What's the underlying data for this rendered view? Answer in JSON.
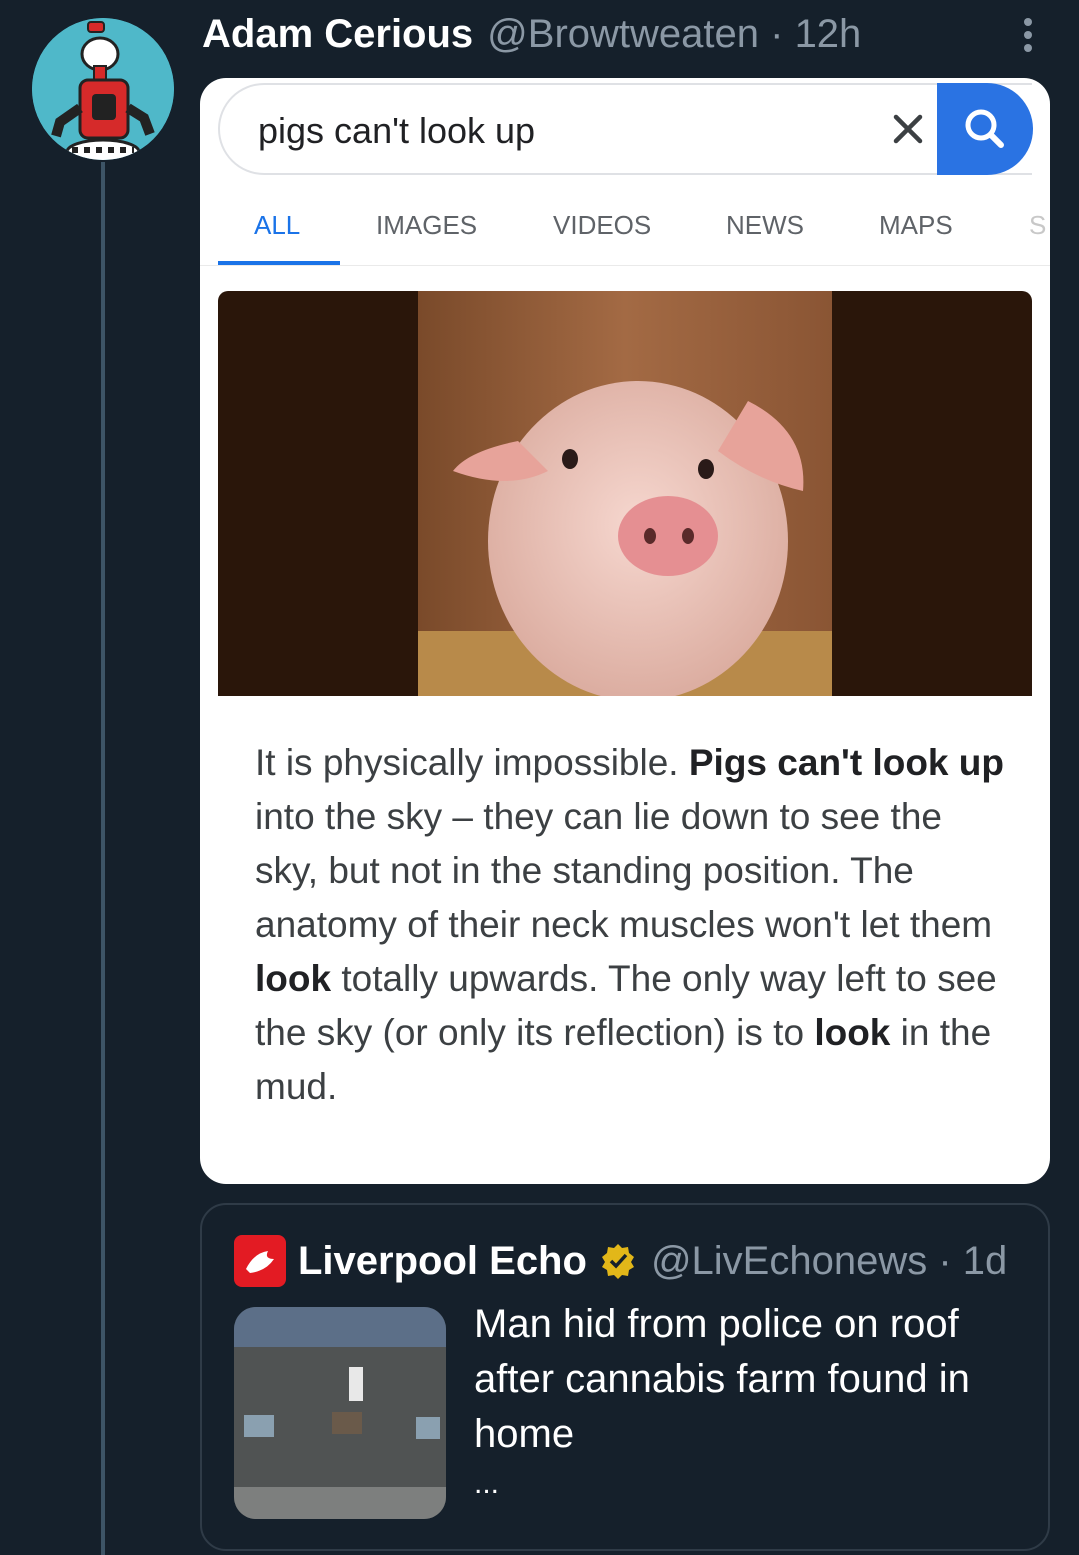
{
  "tweet": {
    "author_name": "Adam Cerious",
    "handle": "@Browtweaten",
    "separator": " · ",
    "time": "12h"
  },
  "search": {
    "query": "pigs can't look up",
    "tabs": [
      {
        "label": "ALL",
        "active": true
      },
      {
        "label": "IMAGES",
        "active": false
      },
      {
        "label": "VIDEOS",
        "active": false
      },
      {
        "label": "NEWS",
        "active": false
      },
      {
        "label": "MAPS",
        "active": false
      },
      {
        "label": "S",
        "active": false
      }
    ],
    "answer": {
      "s1": "It is physically impossible. ",
      "b1": "Pigs can't look up",
      "s2": " into the sky – they can lie down to see the sky, but not in the standing position. The anatomy of their neck muscles won't let them ",
      "b2": "look",
      "s3": " totally upwards. The only way left to see the sky (or only its reflection) is to ",
      "b3": "look",
      "s4": " in the mud."
    }
  },
  "quoted": {
    "name": "Liverpool Echo",
    "handle": "@LivEchonews",
    "separator": " · ",
    "time": "1d",
    "headline": "Man hid from police on roof after cannabis farm found in home",
    "ellipsis": "..."
  },
  "colors": {
    "background": "#15202b",
    "accent_blue": "#1a73e8",
    "search_button": "#2a73e3",
    "verified_gold": "#e2b719",
    "echo_red": "#e31b23"
  }
}
